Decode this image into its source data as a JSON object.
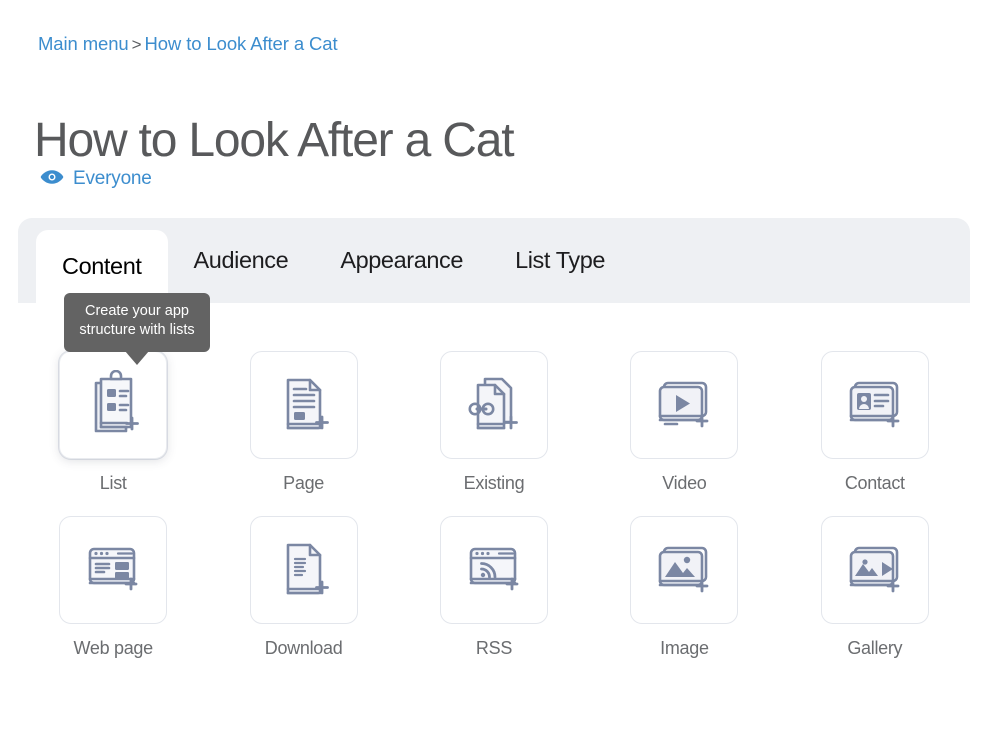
{
  "breadcrumb": {
    "parent": "Main menu",
    "separator": ">",
    "current": "How to Look After a Cat"
  },
  "page_title": "How to Look After a Cat",
  "visibility": {
    "icon": "eye-icon",
    "label": "Everyone",
    "color": "#3c8dce"
  },
  "tabs": [
    {
      "label": "Content",
      "active": true
    },
    {
      "label": "Audience",
      "active": false
    },
    {
      "label": "Appearance",
      "active": false
    },
    {
      "label": "List Type",
      "active": false
    }
  ],
  "tooltip": {
    "text": "Create your app structure with lists",
    "background": "#636363",
    "text_color": "#ffffff"
  },
  "tiles": [
    {
      "label": "List",
      "icon": "clipboard-list-add-icon",
      "selected": true
    },
    {
      "label": "Page",
      "icon": "document-page-add-icon",
      "selected": false
    },
    {
      "label": "Existing",
      "icon": "linked-documents-add-icon",
      "selected": false
    },
    {
      "label": "Video",
      "icon": "video-play-add-icon",
      "selected": false
    },
    {
      "label": "Contact",
      "icon": "contact-card-add-icon",
      "selected": false
    },
    {
      "label": "Web page",
      "icon": "browser-window-add-icon",
      "selected": false
    },
    {
      "label": "Download",
      "icon": "document-download-add-icon",
      "selected": false
    },
    {
      "label": "RSS",
      "icon": "browser-rss-add-icon",
      "selected": false
    },
    {
      "label": "Image",
      "icon": "image-photo-add-icon",
      "selected": false
    },
    {
      "label": "Gallery",
      "icon": "image-gallery-add-icon",
      "selected": false
    }
  ],
  "colors": {
    "accent_blue": "#3c8dce",
    "title_gray": "#58595b",
    "panel_gray": "#eef0f3",
    "icon_stroke": "#7b87a3",
    "icon_fill": "#f0f2f6",
    "tile_border": "#e3e6ec",
    "label_gray": "#6b6d70"
  }
}
